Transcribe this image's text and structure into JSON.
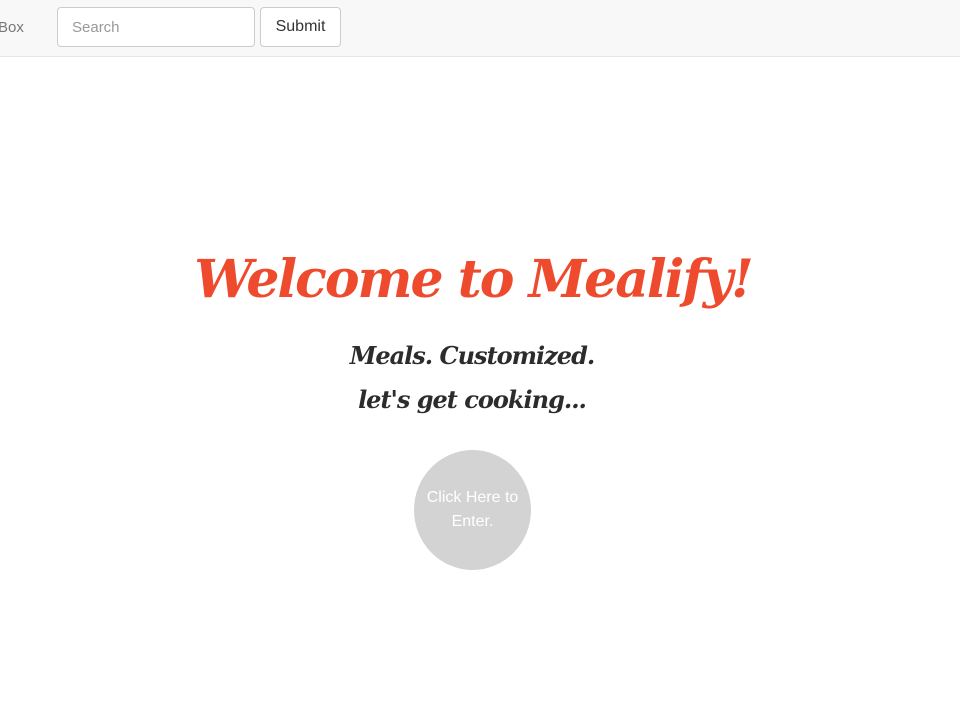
{
  "navbar": {
    "brand_text": "Box",
    "search": {
      "placeholder": "Search",
      "value": ""
    },
    "submit_label": "Submit"
  },
  "hero": {
    "title": "Welcome to Mealify!",
    "tagline_line1": "Meals. Customized.",
    "tagline_line2": "let's get cooking...",
    "enter_label": "Click Here to Enter."
  },
  "colors": {
    "title": "#ee4a2e",
    "tagline": "#2c2c2c",
    "enter_button": "#d3d3d3",
    "navbar_bg": "#f8f8f8"
  }
}
